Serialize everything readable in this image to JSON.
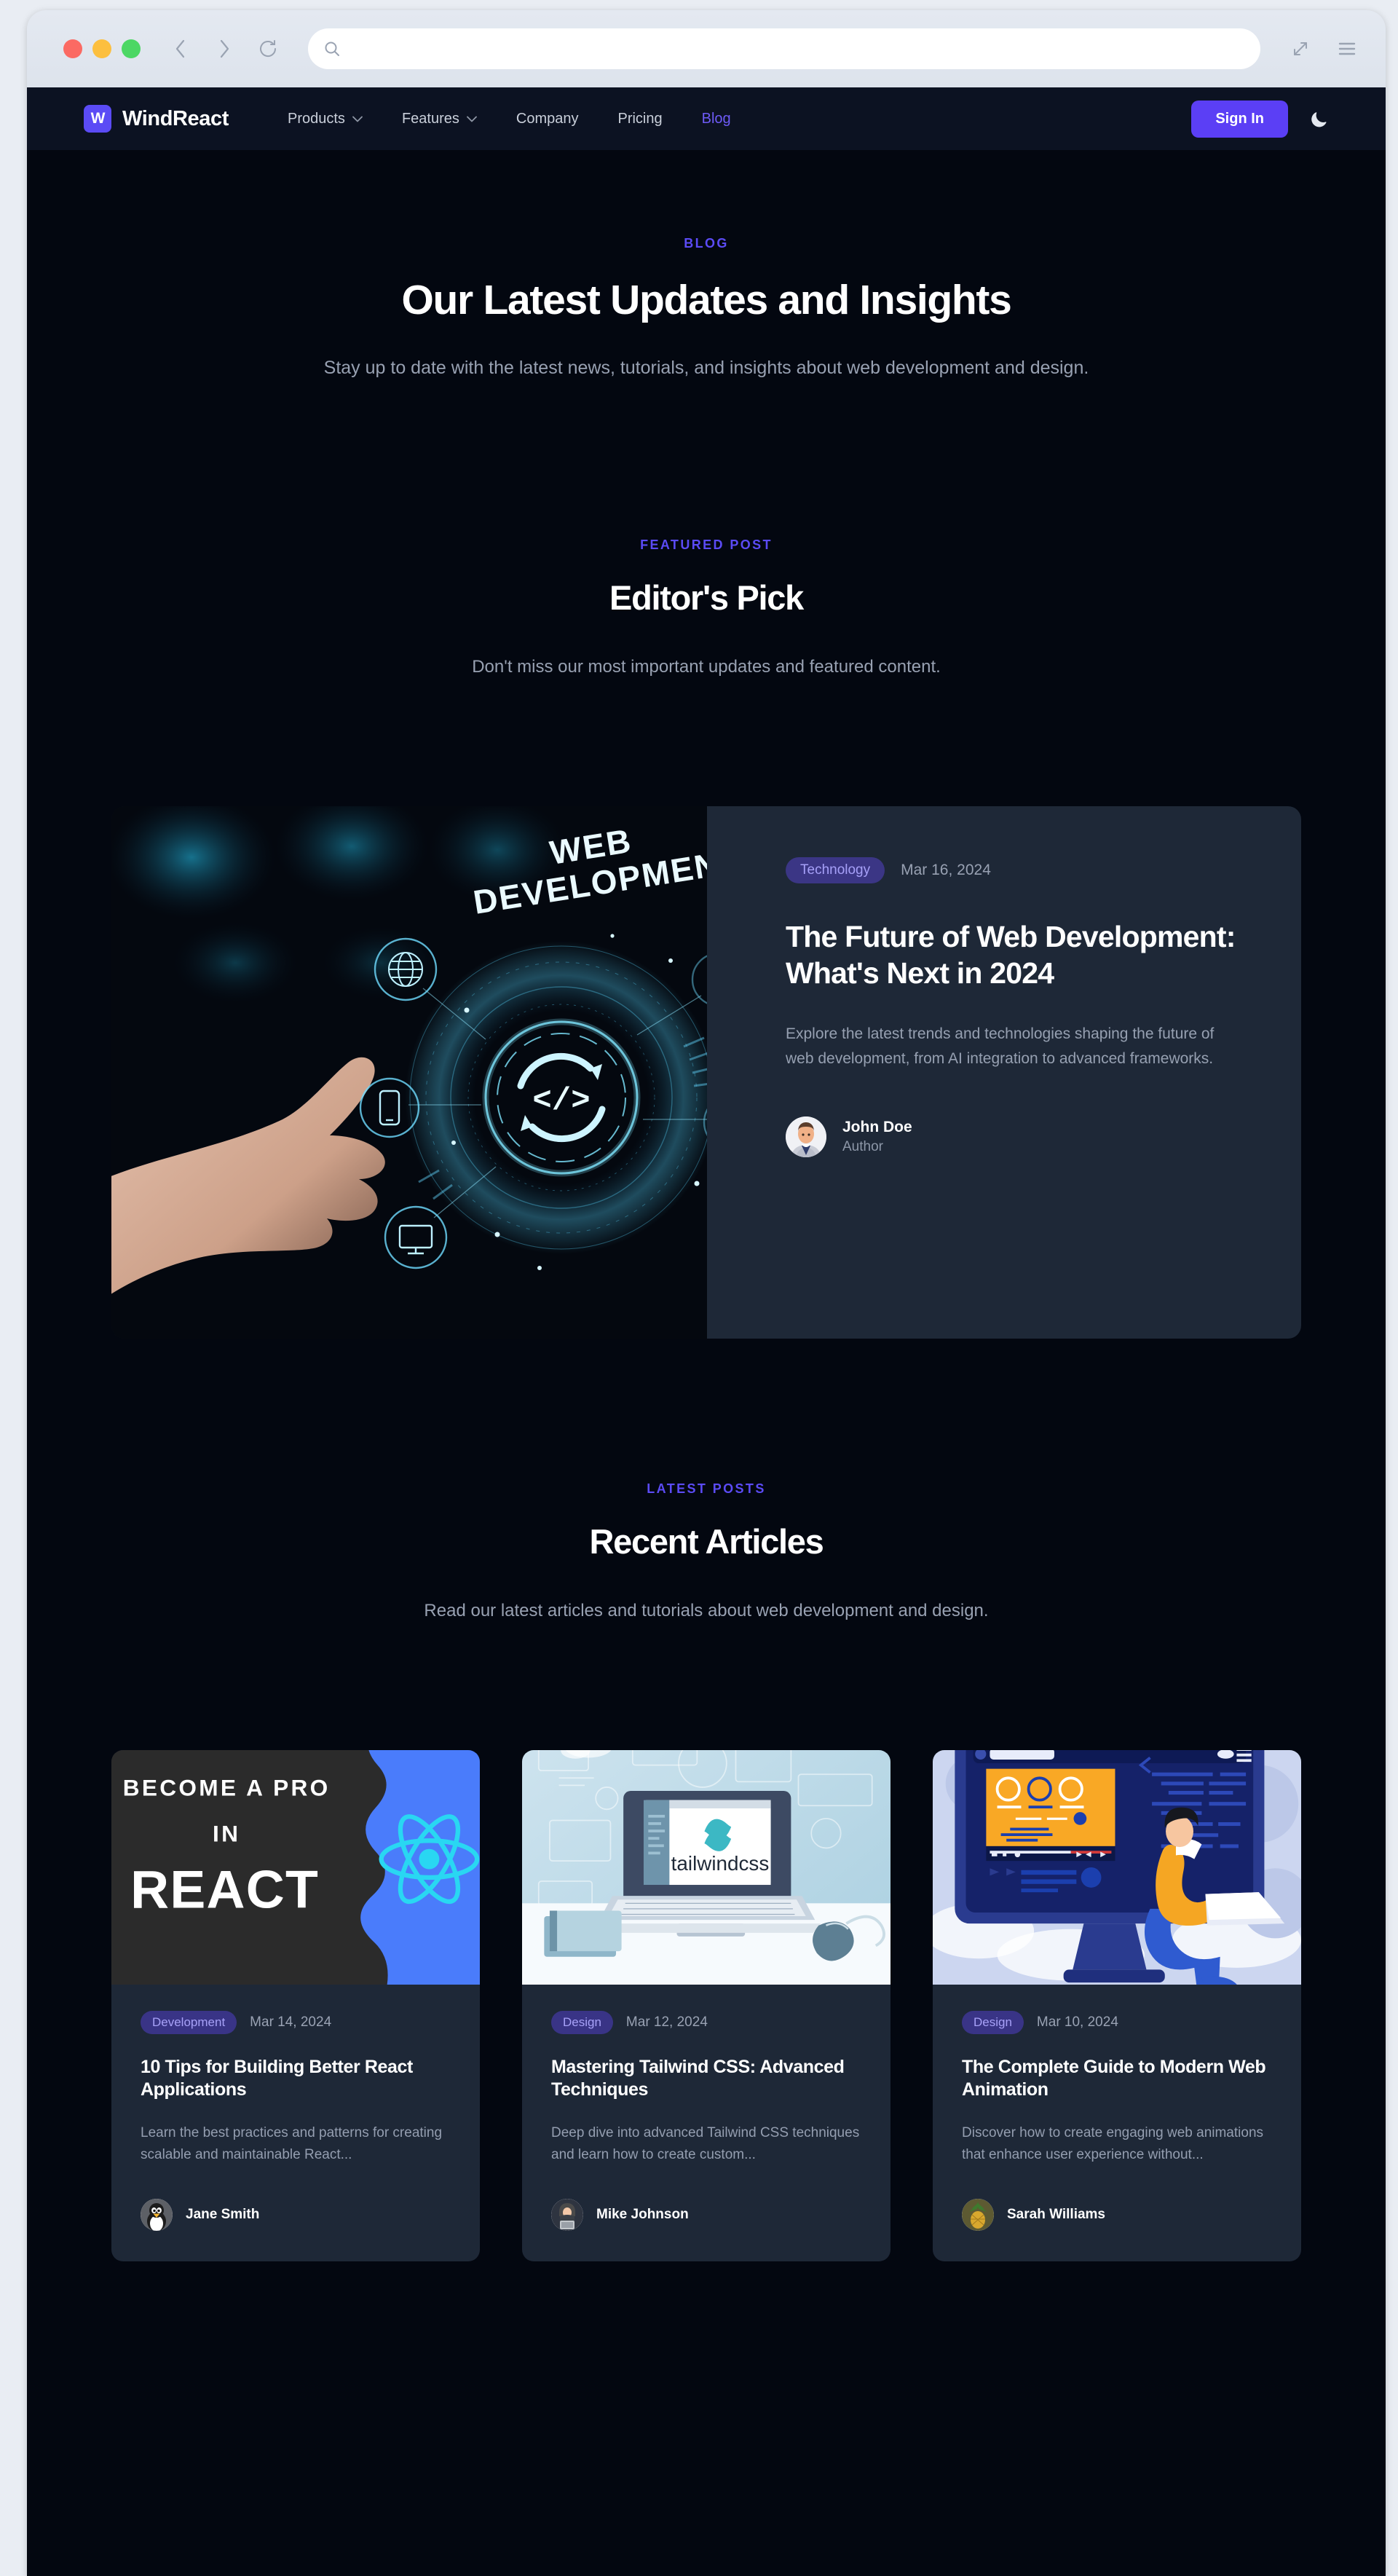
{
  "browser": {
    "url_value": "",
    "url_placeholder": "",
    "icons": [
      "back-icon",
      "forward-icon",
      "reload-icon",
      "search-icon",
      "expand-icon",
      "menu-icon"
    ]
  },
  "navbar": {
    "brand_mark": "W",
    "brand_name": "WindReact",
    "links": [
      {
        "label": "Products",
        "has_caret": true,
        "caret": "⌄",
        "active": false
      },
      {
        "label": "Features",
        "has_caret": true,
        "caret": "⌄",
        "active": false
      },
      {
        "label": "Company",
        "has_caret": false,
        "active": false
      },
      {
        "label": "Pricing",
        "has_caret": false,
        "active": false
      },
      {
        "label": "Blog",
        "has_caret": false,
        "active": true
      }
    ],
    "signin_label": "Sign In",
    "theme_icon": "moon-icon",
    "accent_color": "#5b3ff5"
  },
  "hero": {
    "eyebrow": "BLOG",
    "title": "Our Latest Updates and Insights",
    "subtitle": "Stay up to date with the latest news, tutorials, and insights about web development and design."
  },
  "featured_section": {
    "eyebrow": "FEATURED POST",
    "title": "Editor's Pick",
    "subtitle": "Don't miss our most important updates and featured content."
  },
  "featured_post": {
    "category": "Technology",
    "date": "Mar 16, 2024",
    "title": "The Future of Web Development: What's Next in 2024",
    "excerpt": "Explore the latest trends and technologies shaping the future of web development, from AI integration to advanced frameworks.",
    "author_name": "John Doe",
    "author_role": "Author",
    "image_alt": "WEB DEVELOPMENT",
    "image_text_line1": "WEB",
    "image_text_line2": "DEVELOPMENT"
  },
  "recent_section": {
    "eyebrow": "LATEST POSTS",
    "title": "Recent Articles",
    "subtitle": "Read our latest articles and tutorials about web development and design."
  },
  "articles": [
    {
      "category": "Development",
      "date": "Mar 14, 2024",
      "title": "10 Tips for Building Better React Applications",
      "excerpt": "Learn the best practices and patterns for creating scalable and maintainable React...",
      "author_name": "Jane Smith",
      "image_text_line1": "BECOME A PRO",
      "image_text_line2": "IN",
      "image_text_line3": "REACT"
    },
    {
      "category": "Design",
      "date": "Mar 12, 2024",
      "title": "Mastering Tailwind CSS: Advanced Techniques",
      "excerpt": "Deep dive into advanced Tailwind CSS techniques and learn how to create custom...",
      "author_name": "Mike Johnson",
      "image_text_line1": "tailwindcss"
    },
    {
      "category": "Design",
      "date": "Mar 10, 2024",
      "title": "The Complete Guide to Modern Web Animation",
      "excerpt": "Discover how to create engaging web animations that enhance user experience without...",
      "author_name": "Sarah Williams",
      "image_text_line1": ""
    }
  ],
  "colors": {
    "page_bg": "#030710",
    "nav_bg": "#0c1222",
    "card_bg": "#1e2837",
    "accent": "#5b3ff5",
    "eyebrow": "#5b4bf5",
    "muted_text": "#98a1b2",
    "pill_bg": "#3b3685",
    "pill_text": "#a6a0f8"
  }
}
